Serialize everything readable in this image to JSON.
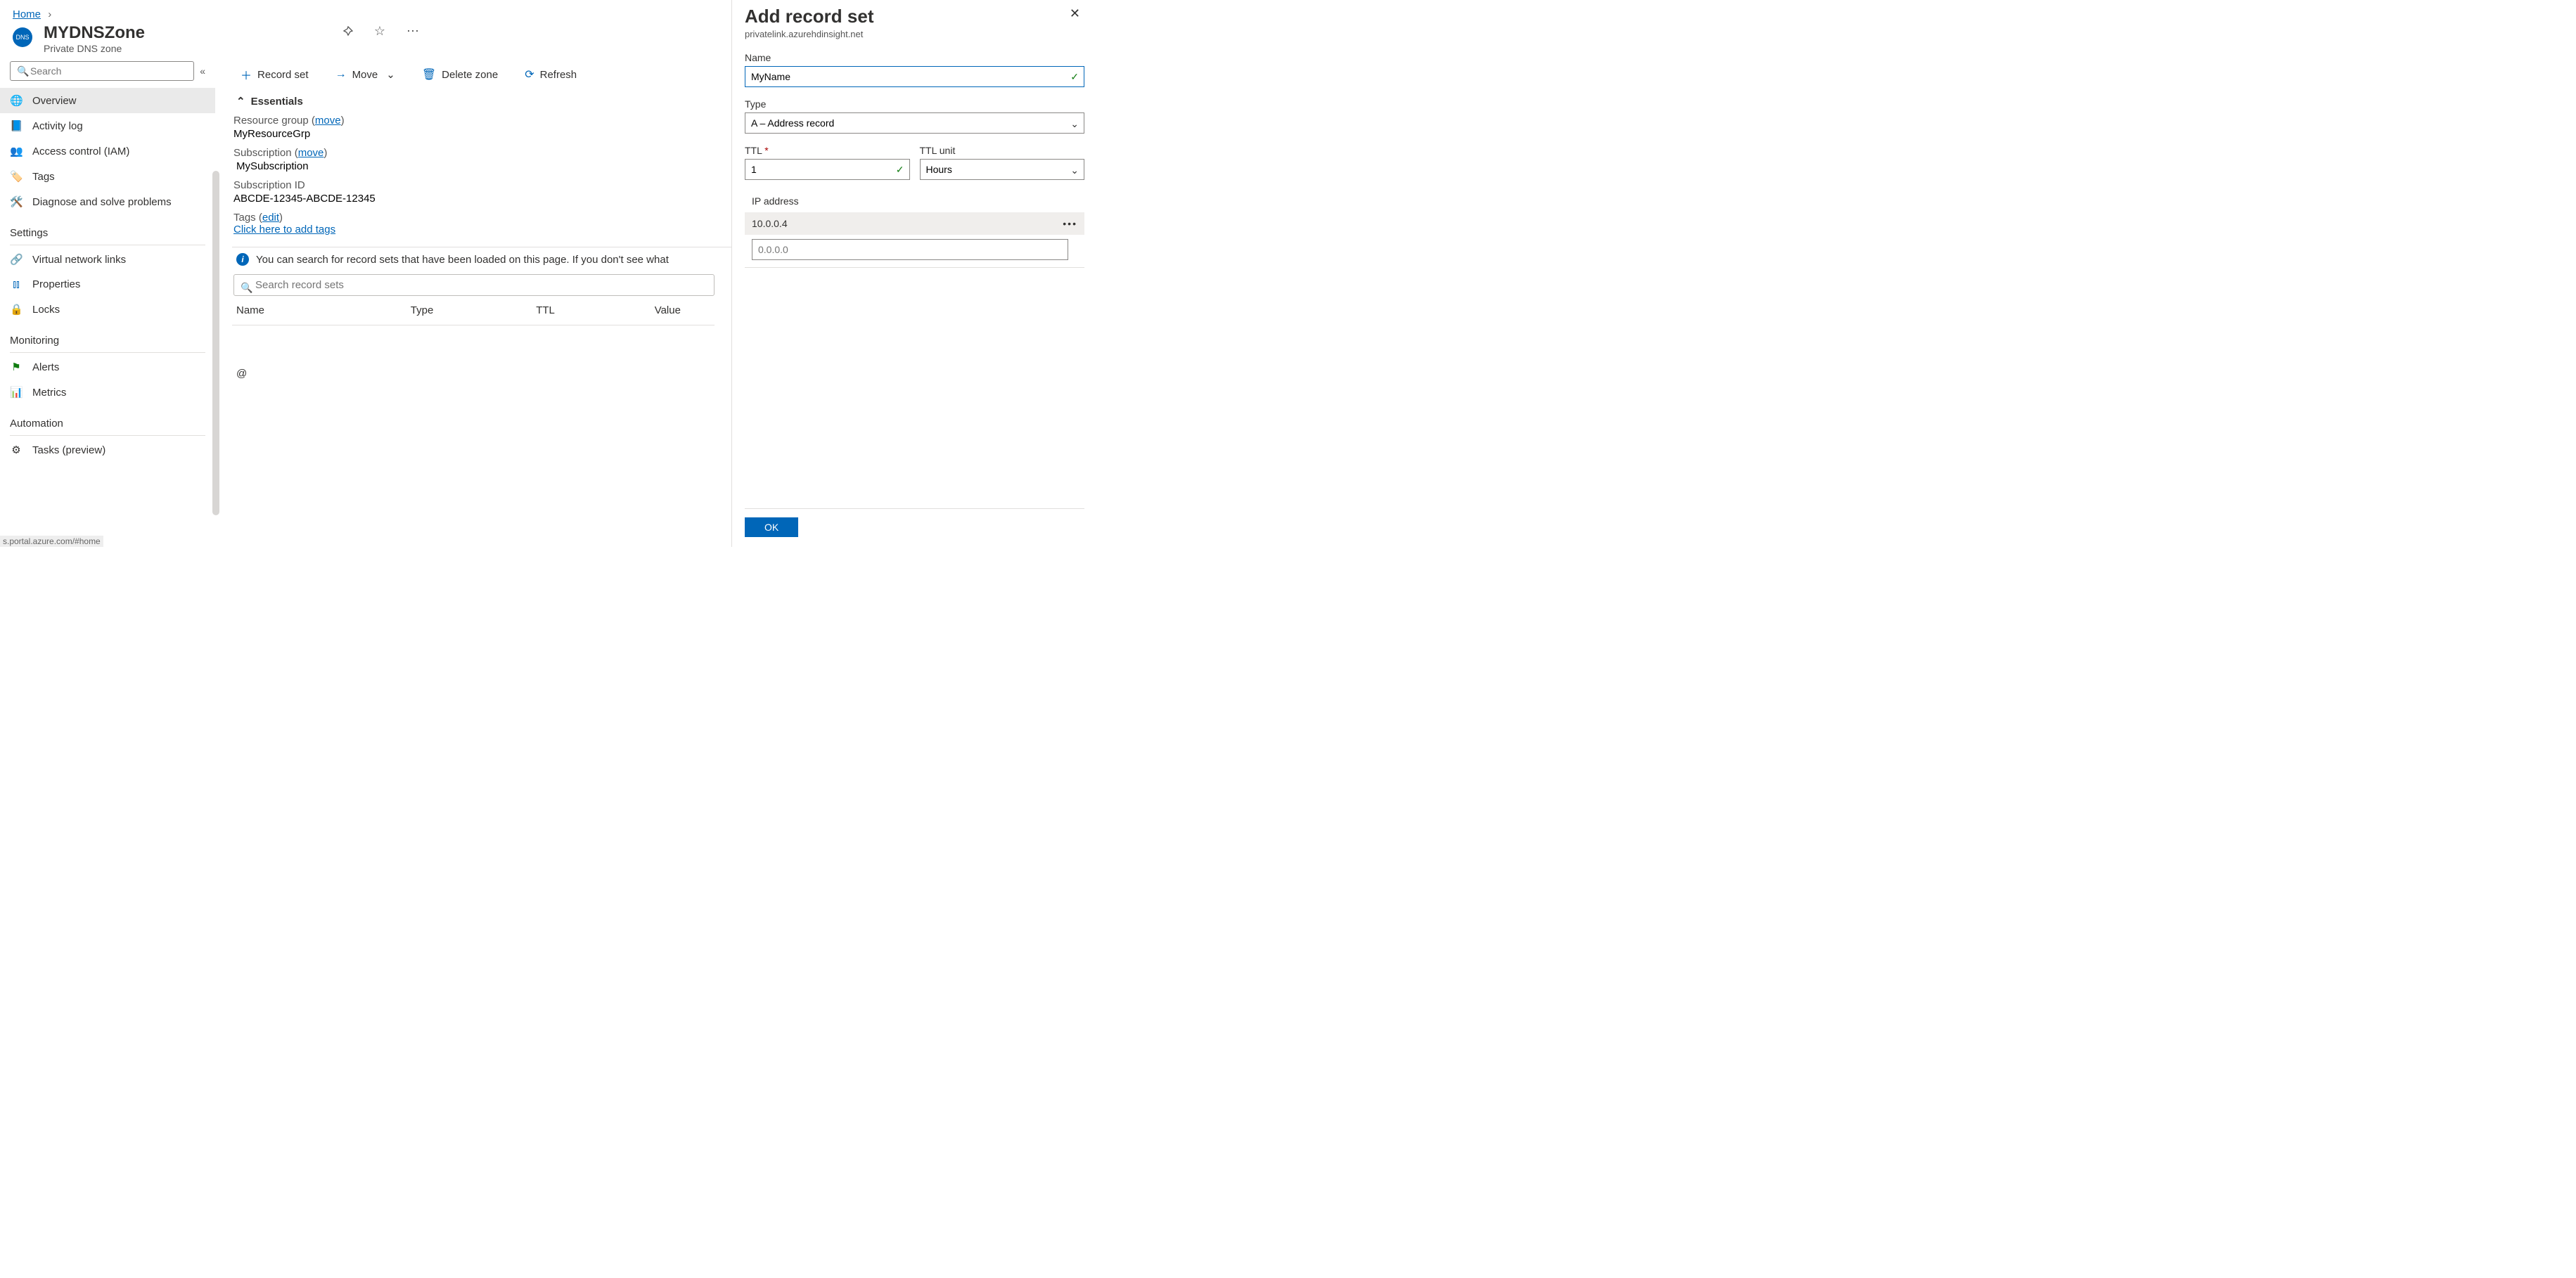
{
  "breadcrumb": {
    "home": "Home"
  },
  "header": {
    "icon_label": "DNS",
    "title": "MYDNSZone",
    "subtitle": "Private DNS zone"
  },
  "sidebar": {
    "search_placeholder": "Search",
    "items": [
      {
        "icon": "🌐",
        "label": "Overview",
        "active": true
      },
      {
        "icon": "📘",
        "label": "Activity log"
      },
      {
        "icon": "👥",
        "label": "Access control (IAM)"
      },
      {
        "icon": "🏷️",
        "label": "Tags"
      },
      {
        "icon": "🛠️",
        "label": "Diagnose and solve problems"
      }
    ],
    "sections": [
      {
        "title": "Settings",
        "items": [
          {
            "icon": "🔗",
            "label": "Virtual network links"
          },
          {
            "icon": "⫾⫾",
            "label": "Properties"
          },
          {
            "icon": "🔒",
            "label": "Locks"
          }
        ]
      },
      {
        "title": "Monitoring",
        "items": [
          {
            "icon": "⚑",
            "label": "Alerts"
          },
          {
            "icon": "📊",
            "label": "Metrics"
          }
        ]
      },
      {
        "title": "Automation",
        "items": [
          {
            "icon": "⚙",
            "label": "Tasks (preview)"
          }
        ]
      }
    ]
  },
  "toolbar": {
    "record_set": "Record set",
    "move": "Move",
    "delete_zone": "Delete zone",
    "refresh": "Refresh"
  },
  "essentials": {
    "heading": "Essentials",
    "resource_group_label": "Resource group",
    "resource_group_move": "move",
    "resource_group_value": "MyResourceGrp",
    "subscription_label": "Subscription",
    "subscription_move": "move",
    "subscription_value": "MySubscription",
    "subscription_id_label": "Subscription ID",
    "subscription_id_value": "ABCDE-12345-ABCDE-12345",
    "tags_label": "Tags",
    "tags_edit": "edit",
    "tags_add": "Click here to add tags"
  },
  "info_bar": "You can search for record sets that have been loaded on this page. If you don't see what",
  "record_search_placeholder": "Search record sets",
  "grid": {
    "cols": [
      "Name",
      "Type",
      "TTL",
      "Value"
    ],
    "first_row_name": "@"
  },
  "flyout": {
    "title": "Add record set",
    "subtitle": "privatelink.azurehdinsight.net",
    "name_label": "Name",
    "name_value": "MyName",
    "type_label": "Type",
    "type_value": "A – Address record",
    "ttl_label": "TTL",
    "ttl_value": "1",
    "ttl_unit_label": "TTL unit",
    "ttl_unit_value": "Hours",
    "ip_label": "IP address",
    "ip_rows": [
      "10.0.0.4"
    ],
    "ip_placeholder": "0.0.0.0",
    "ok": "OK"
  },
  "status_url": "s.portal.azure.com/#home"
}
